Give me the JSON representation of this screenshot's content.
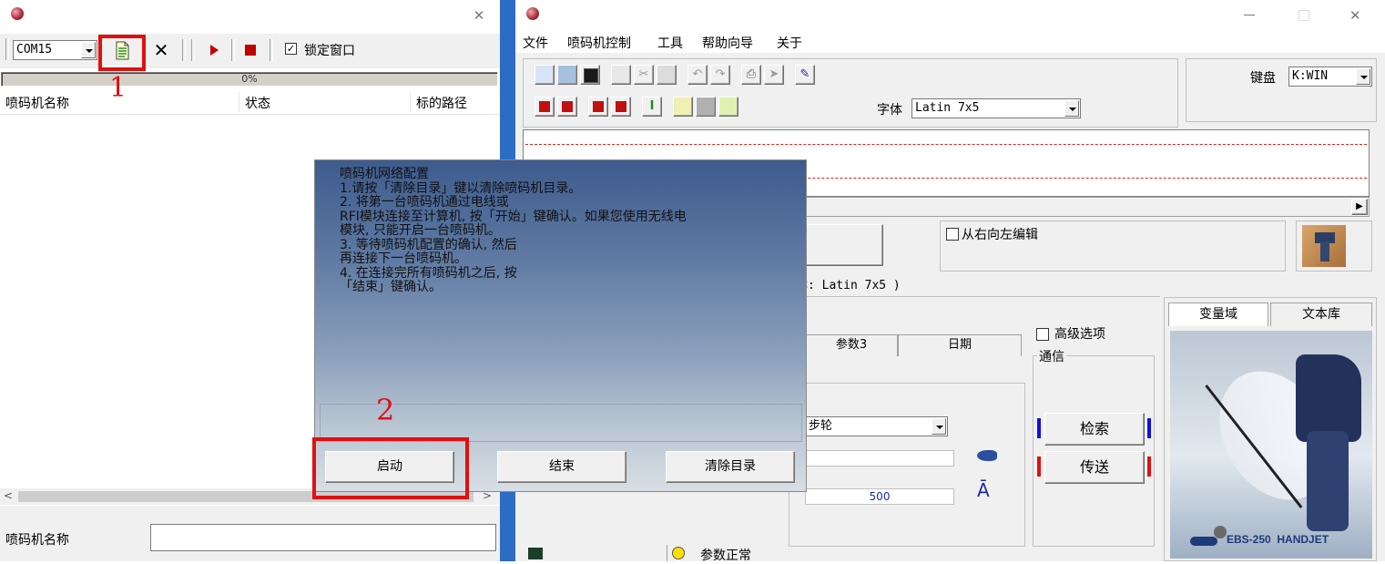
{
  "left_window": {
    "close_glyph": "✕",
    "com_port": "COM15",
    "lock_label": "锁定窗口",
    "progress": "0%",
    "progress_value": 0,
    "columns": [
      "喷码机名称",
      "状态",
      "标的路径"
    ],
    "name_label": "喷码机名称",
    "name_value": ""
  },
  "right_window": {
    "menu": [
      "文件",
      "喷码机控制",
      "工具",
      "帮助向导",
      "关于"
    ],
    "keyboard_label": "键盘",
    "keyboard_value": "K:WIN",
    "font_label": "字体",
    "font_value": "Latin 7x5",
    "rtl_label": "从右向左编辑",
    "font_info": "体: Latin 7x5 )",
    "advanced_label": "高级选项",
    "tabs": [
      "参数3",
      "日期"
    ],
    "comm_label": "通信",
    "search_label": "检索",
    "send_label": "传送",
    "step_value": "步轮",
    "slider_value": "500",
    "right_tabs": [
      "变量域",
      "文本库"
    ],
    "product_text": "EBS-250  HANDJET",
    "status_text": "参数正常"
  },
  "dialog": {
    "title": "喷码机网络配置",
    "lines": [
      "1.请按「清除目录」键以清除喷码机目录。",
      "2. 将第一台喷码机通过电线或",
      "RFI模块连接至计算机, 按「开始」键确认。如果您使用无线电",
      "模块, 只能开启一台喷码机。",
      "3. 等待喷码机配置的确认, 然后",
      "再连接下一台喷码机。",
      "4. 在连接完所有喷码机之后, 按",
      "「结束」键确认。"
    ],
    "start_label": "启动",
    "end_label": "结束",
    "clear_label": "清除目录"
  },
  "annotations": [
    "1",
    "2"
  ],
  "colors": {
    "annotation_red": "#e01010",
    "dialog_top": "#3c5a8c",
    "dialog_bottom": "#c9d3dd"
  }
}
